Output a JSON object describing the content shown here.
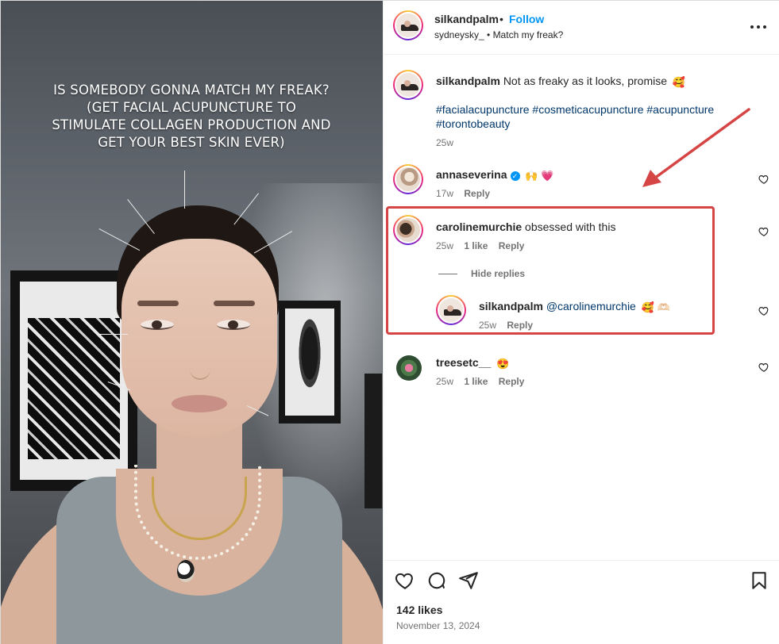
{
  "media": {
    "caption_lines": [
      "IS SOMEBODY GONNA MATCH MY FREAK?",
      "(GET FACIAL ACUPUNCTURE TO",
      "STIMULATE COLLAGEN PRODUCTION AND",
      "GET YOUR BEST SKIN EVER)"
    ]
  },
  "header": {
    "username": "silkandpalm",
    "separator": "•",
    "follow_label": "Follow",
    "subtitle": "sydneysky_ • Match my freak?",
    "more_icon": "more-horizontal-icon"
  },
  "post_caption": {
    "username": "silkandpalm",
    "text": "Not as freaky as it looks, promise",
    "emoji": "🥰",
    "hashtags_line1": "#facialacupuncture #cosmeticacupuncture #acupuncture",
    "hashtags_line2": "#torontobeauty",
    "time": "25w"
  },
  "comments": [
    {
      "username": "annaseverina",
      "verified": true,
      "text": "",
      "emoji": "🙌 💗",
      "time": "17w",
      "likes": "",
      "reply_label": "Reply"
    },
    {
      "username": "carolinemurchie",
      "verified": false,
      "text": "obsessed with this",
      "emoji": "",
      "time": "25w",
      "likes": "1 like",
      "reply_label": "Reply"
    },
    {
      "username": "treesetc__",
      "verified": false,
      "text": "",
      "emoji": "😍",
      "time": "25w",
      "likes": "1 like",
      "reply_label": "Reply"
    }
  ],
  "hide_replies_label": "Hide replies",
  "reply": {
    "username": "silkandpalm",
    "mention": "@carolinemurchie",
    "emoji": "🥰 🫶🏻",
    "time": "25w",
    "reply_label": "Reply"
  },
  "footer": {
    "likes": "142 likes",
    "date": "November 13, 2024",
    "icons": [
      "heart-icon",
      "comment-icon",
      "share-icon",
      "bookmark-icon"
    ]
  },
  "colors": {
    "accent_blue": "#0095f6",
    "annotation_red": "#d64545",
    "muted_text": "#737373",
    "hashtag": "#00376b"
  }
}
